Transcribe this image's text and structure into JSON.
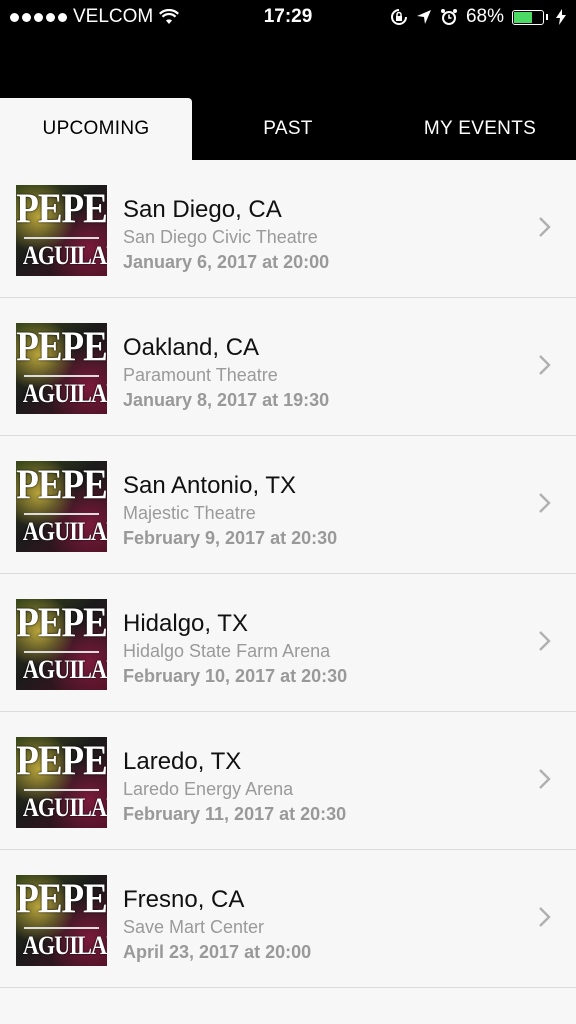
{
  "status": {
    "carrier": "VELCOM",
    "time": "17:29",
    "battery": "68%",
    "battery_level": 0.68
  },
  "tabs": [
    {
      "label": "UPCOMING",
      "active": true
    },
    {
      "label": "PAST",
      "active": false
    },
    {
      "label": "MY EVENTS",
      "active": false
    }
  ],
  "thumbnail": {
    "line1": "PEPE",
    "line2": "AGUILAR"
  },
  "events": [
    {
      "city": "San Diego, CA",
      "venue": "San Diego Civic Theatre",
      "date": "January 6, 2017 at 20:00"
    },
    {
      "city": "Oakland, CA",
      "venue": "Paramount Theatre",
      "date": "January 8, 2017 at 19:30"
    },
    {
      "city": "San Antonio, TX",
      "venue": "Majestic Theatre",
      "date": "February 9, 2017 at 20:30"
    },
    {
      "city": "Hidalgo, TX",
      "venue": "Hidalgo State Farm Arena",
      "date": "February 10, 2017 at 20:30"
    },
    {
      "city": "Laredo, TX",
      "venue": "Laredo Energy Arena",
      "date": "February 11, 2017 at 20:30"
    },
    {
      "city": "Fresno, CA",
      "venue": "Save Mart Center",
      "date": "April 23, 2017 at 20:00"
    }
  ]
}
